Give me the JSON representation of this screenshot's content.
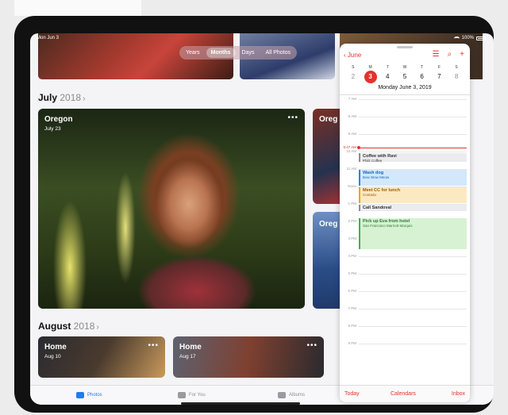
{
  "status": {
    "time": "Mon Jun 3",
    "battery": "100%"
  },
  "photos": {
    "segments": [
      {
        "label": "Years",
        "active": false
      },
      {
        "label": "Months",
        "active": true
      },
      {
        "label": "Days",
        "active": false
      },
      {
        "label": "All Photos",
        "active": false
      }
    ],
    "sections": [
      {
        "month": "July",
        "year": "2018"
      },
      {
        "month": "August",
        "year": "2018"
      }
    ],
    "cards": {
      "oregon_main": {
        "title": "Oregon",
        "date": "July 23"
      },
      "oregon_side1": {
        "title": "Oreg"
      },
      "oregon_side2": {
        "title": "Oreg"
      },
      "home1": {
        "title": "Home",
        "date": "Aug 10"
      },
      "home2": {
        "title": "Home",
        "date": "Aug 17"
      }
    },
    "more_glyph": "•••",
    "tabs": [
      {
        "label": "Photos",
        "selected": true,
        "icon": "photos-icon"
      },
      {
        "label": "For You",
        "selected": false,
        "icon": "for-you-icon"
      },
      {
        "label": "Albums",
        "selected": false,
        "icon": "albums-icon"
      }
    ]
  },
  "calendar": {
    "back_label": "June",
    "weekdays": [
      "S",
      "M",
      "T",
      "W",
      "T",
      "F",
      "S"
    ],
    "dates": [
      "2",
      "3",
      "4",
      "5",
      "6",
      "7",
      "8"
    ],
    "today_index": 1,
    "selected_date": "Monday  June 3, 2019",
    "hours": [
      "7 AM",
      "8 AM",
      "9 AM",
      "10 AM",
      "11 AM",
      "Noon",
      "1 PM",
      "2 PM",
      "3 PM",
      "4 PM",
      "5 PM",
      "6 PM",
      "7 PM",
      "8 PM",
      "9 PM"
    ],
    "now_label": "9:47 AM",
    "events": [
      {
        "title": "Coffee with Ravi",
        "location": "Philz Coffee",
        "color": "#8e8e93",
        "bg": "#ececef"
      },
      {
        "title": "Wash dog",
        "location": "Bow Wow Meow",
        "color": "#1e88e5",
        "bg": "#d3e8fb"
      },
      {
        "title": "Meet CC for lunch",
        "location": "Contadu",
        "color": "#f0a30a",
        "bg": "#fbe9c2"
      },
      {
        "title": "Call Sandoval",
        "location": "",
        "color": "#8e8e93",
        "bg": "#ececef"
      },
      {
        "title": "Pick up Eva from hotel",
        "location": "San Francisco Marriott Marquis",
        "color": "#3fb34f",
        "bg": "#d7f2d3"
      }
    ],
    "footer": {
      "today": "Today",
      "calendars": "Calendars",
      "inbox": "Inbox"
    }
  }
}
